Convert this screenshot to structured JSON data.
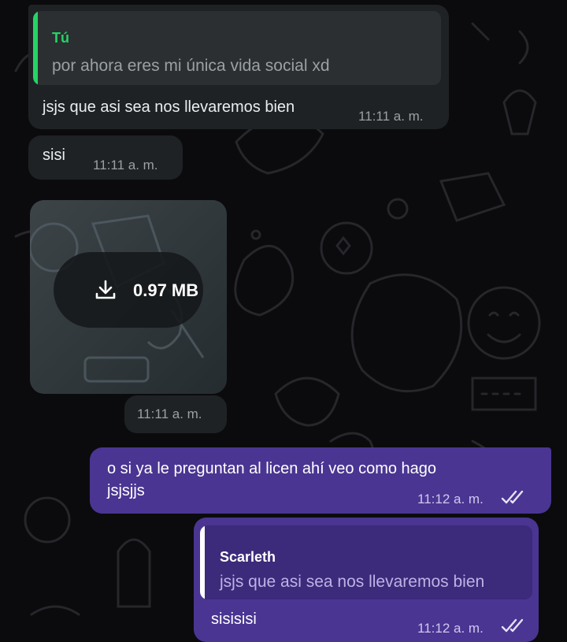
{
  "colors": {
    "incoming_bubble": "#1f2224",
    "outgoing_bubble": "#4a3592",
    "reply_accent_green": "#25d366",
    "reply_accent_white": "#ffffff"
  },
  "messages": {
    "m1": {
      "reply_name": "Tú",
      "reply_text": "por ahora eres mi única vida social xd",
      "text": "jsjs que asi sea nos llevaremos bien",
      "time": "11:11 a. m."
    },
    "m2": {
      "text": "sisi",
      "time": "11:11 a. m."
    },
    "m3": {
      "file_size": "0.97 MB",
      "download_icon": "download-icon",
      "time": "11:11 a. m."
    },
    "m4": {
      "line1": "o si ya le preguntan al licen ahí veo como hago",
      "line2": "jsjsjjs",
      "time": "11:12 a. m.",
      "status_icon": "double-check-icon"
    },
    "m5": {
      "reply_name": "Scarleth",
      "reply_text": "jsjs que asi sea nos llevaremos bien",
      "text": "sisisisi",
      "time": "11:12 a. m.",
      "status_icon": "double-check-icon"
    }
  }
}
